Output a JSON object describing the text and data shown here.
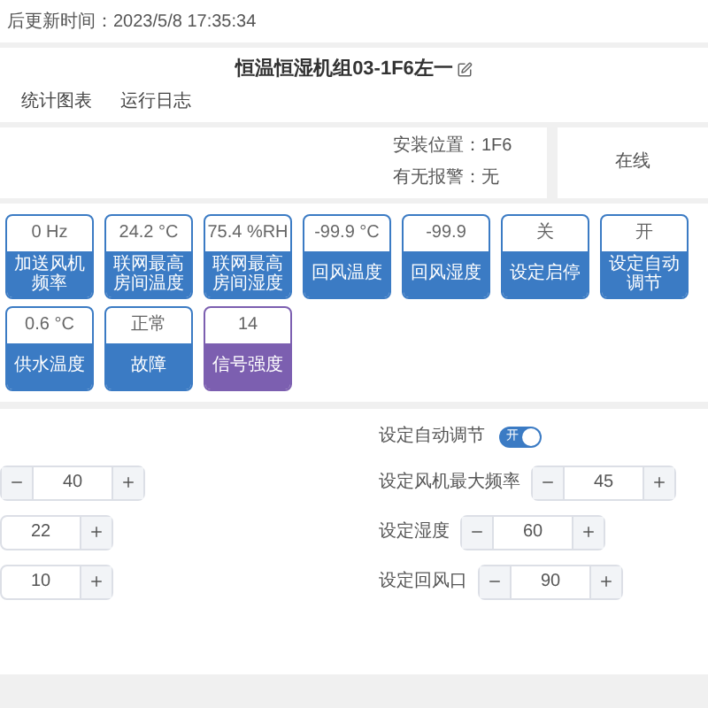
{
  "update_time": "后更新时间：2023/5/8 17:35:34",
  "title": "恒温恒湿机组03-1F6左一",
  "tabs": [
    {
      "label": "统计图表"
    },
    {
      "label": "运行日志"
    }
  ],
  "info": [
    {
      "label": "安装位置：",
      "value": "1F6"
    },
    {
      "label": "有无报警：",
      "value": "无"
    }
  ],
  "status": "在线",
  "tiles": [
    [
      {
        "value": "0 Hz",
        "label": "加送风机频率",
        "color": "#3b7bc4"
      },
      {
        "value": "24.2 °C",
        "label": "联网最高房间温度",
        "color": "#3b7bc4"
      },
      {
        "value": "75.4 %RH",
        "label": "联网最高房间湿度",
        "color": "#3b7bc4"
      },
      {
        "value": "-99.9 °C",
        "label": "回风温度",
        "color": "#3b7bc4"
      },
      {
        "value": "-99.9",
        "label": "回风湿度",
        "color": "#3b7bc4"
      },
      {
        "value": "关",
        "label": "设定启停",
        "color": "#3b7bc4"
      },
      {
        "value": "开",
        "label": "设定自动调节",
        "color": "#3b7bc4"
      }
    ],
    [
      {
        "value": "0.6 °C",
        "label": "供水温度",
        "color": "#3b7bc4"
      },
      {
        "value": "正常",
        "label": "故障",
        "color": "#3b7bc4"
      },
      {
        "value": "14",
        "label": "信号强度",
        "color": "#7c5fb0"
      }
    ]
  ],
  "left_steppers": [
    {
      "value": "40"
    },
    {
      "value": "22"
    },
    {
      "value": "10"
    }
  ],
  "auto_adjust": {
    "label": "设定自动调节",
    "on": true,
    "text": "开"
  },
  "right_steppers": [
    {
      "label": "设定风机最大频率",
      "value": "45"
    },
    {
      "label": "设定湿度",
      "value": "60"
    },
    {
      "label": "设定回风口",
      "value": "90"
    }
  ]
}
